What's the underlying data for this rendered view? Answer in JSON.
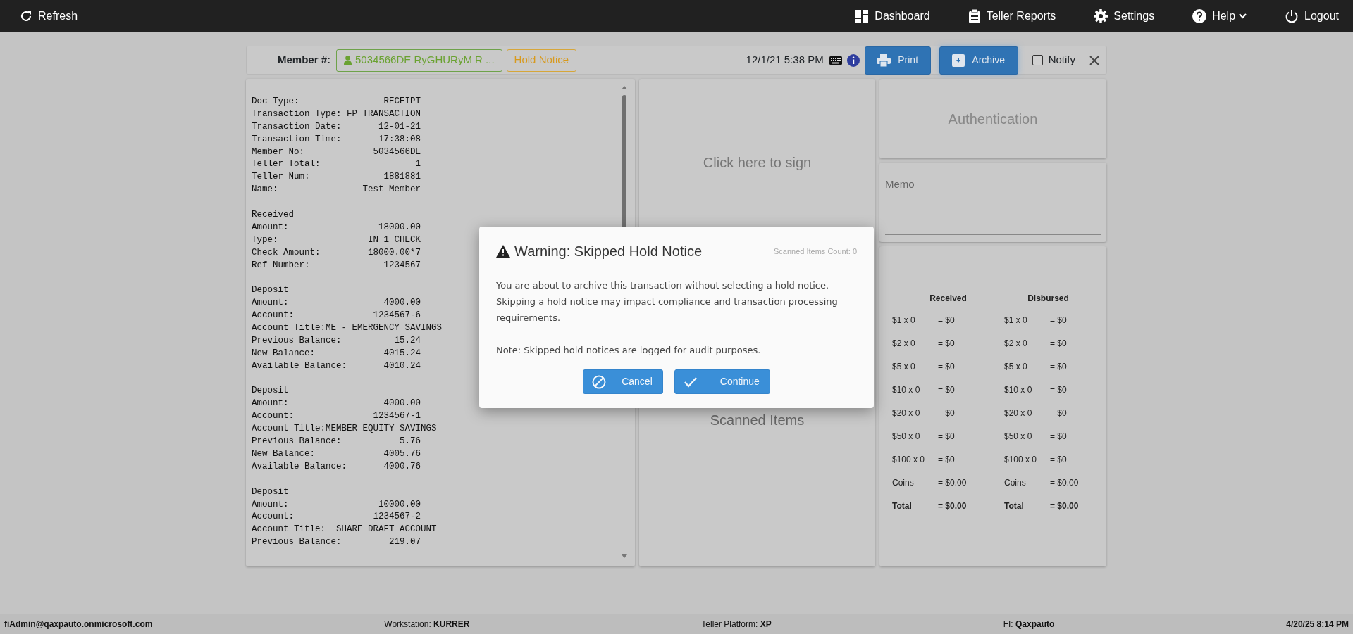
{
  "navbar": {
    "left": [
      {
        "label": "Refresh"
      }
    ],
    "right": [
      {
        "label": "Dashboard",
        "has_menu": false
      },
      {
        "label": "Teller Reports",
        "has_menu": false
      },
      {
        "label": "Settings",
        "has_menu": false
      },
      {
        "label": "Help",
        "has_menu": true
      },
      {
        "label": "Logout",
        "has_menu": false
      }
    ]
  },
  "member_bar": {
    "label": "Member #:",
    "member": "5034566DE RyGHURyM R ...",
    "hold_notice": "Hold Notice",
    "datetime": "12/1/21 5:38 PM",
    "buttons": [
      "Print",
      "Archive"
    ],
    "notify": {
      "label": "Notify",
      "checked": false
    }
  },
  "receipt": {
    "sections": [
      [
        {
          "kind": "pair",
          "label": "Doc Type:",
          "value": "RECEIPT"
        },
        {
          "kind": "pair",
          "label": "Transaction Type:",
          "value": "FP TRANSACTION"
        },
        {
          "kind": "pair",
          "label": "Transaction Date:",
          "value": "12-01-21"
        },
        {
          "kind": "pair",
          "label": "Transaction Time:",
          "value": "17:38:08"
        },
        {
          "kind": "pair",
          "label": "Member No:",
          "value": "5034566DE"
        },
        {
          "kind": "pair",
          "label": "Teller Total:",
          "value": "1"
        },
        {
          "kind": "pair",
          "label": "Teller Num:",
          "value": "1881881"
        },
        {
          "kind": "pair",
          "label": "Name:",
          "value": "Test Member"
        }
      ],
      [
        {
          "kind": "line",
          "text": "Received"
        },
        {
          "kind": "pair",
          "label": "Amount:",
          "value": "18000.00"
        },
        {
          "kind": "pair",
          "label": "Type:",
          "value": "IN 1 CHECK"
        },
        {
          "kind": "pair",
          "label": "Check Amount:",
          "value": "18000.00*7"
        },
        {
          "kind": "pair",
          "label": "Ref Number:",
          "value": "1234567"
        }
      ],
      [
        {
          "kind": "line",
          "text": "Deposit"
        },
        {
          "kind": "pair",
          "label": "Amount:",
          "value": "4000.00"
        },
        {
          "kind": "pair",
          "label": "Account:",
          "value": "1234567-6"
        },
        {
          "kind": "line",
          "text": "Account Title:ME - EMERGENCY SAVINGS"
        },
        {
          "kind": "pair",
          "label": "Previous Balance:",
          "value": "15.24"
        },
        {
          "kind": "pair",
          "label": "New Balance:",
          "value": "4015.24"
        },
        {
          "kind": "pair",
          "label": "Available Balance:",
          "value": "4010.24"
        }
      ],
      [
        {
          "kind": "line",
          "text": "Deposit"
        },
        {
          "kind": "pair",
          "label": "Amount:",
          "value": "4000.00"
        },
        {
          "kind": "pair",
          "label": "Account:",
          "value": "1234567-1"
        },
        {
          "kind": "line",
          "text": "Account Title:MEMBER EQUITY SAVINGS"
        },
        {
          "kind": "pair",
          "label": "Previous Balance:",
          "value": "5.76"
        },
        {
          "kind": "pair",
          "label": "New Balance:",
          "value": "4005.76"
        },
        {
          "kind": "pair",
          "label": "Available Balance:",
          "value": "4000.76"
        }
      ],
      [
        {
          "kind": "line",
          "text": "Deposit"
        },
        {
          "kind": "pair",
          "label": "Amount:",
          "value": "10000.00"
        },
        {
          "kind": "pair",
          "label": "Account:",
          "value": "1234567-2"
        },
        {
          "kind": "line",
          "text": "Account Title:  SHARE DRAFT ACCOUNT"
        },
        {
          "kind": "pair",
          "label": "Previous Balance:",
          "value": "219.07"
        }
      ]
    ]
  },
  "signature": {
    "prompt": "Click here to sign"
  },
  "scanned": {
    "title": "Scanned Items",
    "count": "Scanned Items Count: 0"
  },
  "authentication": {
    "title": "Authentication"
  },
  "memo": {
    "label": "Memo"
  },
  "cash": {
    "columns": [
      {
        "heading": "Received",
        "rows": [
          {
            "kind": "line",
            "label": "$1 x 0",
            "amount": "= $0"
          },
          {
            "kind": "line",
            "label": "$2 x 0",
            "amount": "= $0"
          },
          {
            "kind": "line",
            "label": "$5 x 0",
            "amount": "= $0"
          },
          {
            "kind": "line",
            "label": "$10 x 0",
            "amount": "= $0"
          },
          {
            "kind": "line",
            "label": "$20 x 0",
            "amount": "= $0"
          },
          {
            "kind": "line",
            "label": "$50 x 0",
            "amount": "= $0"
          },
          {
            "kind": "line",
            "label": "$100 x 0",
            "amount": "= $0"
          },
          {
            "kind": "line",
            "label": "Coins",
            "amount": "= $0.00"
          },
          {
            "kind": "total",
            "label": "Total",
            "amount": "= $0.00"
          }
        ]
      },
      {
        "heading": "Disbursed",
        "rows": [
          {
            "kind": "line",
            "label": "$1 x 0",
            "amount": "= $0"
          },
          {
            "kind": "line",
            "label": "$2 x 0",
            "amount": "= $0"
          },
          {
            "kind": "line",
            "label": "$5 x 0",
            "amount": "= $0"
          },
          {
            "kind": "line",
            "label": "$10 x 0",
            "amount": "= $0"
          },
          {
            "kind": "line",
            "label": "$20 x 0",
            "amount": "= $0"
          },
          {
            "kind": "line",
            "label": "$50 x 0",
            "amount": "= $0"
          },
          {
            "kind": "line",
            "label": "$100 x 0",
            "amount": "= $0"
          },
          {
            "kind": "line",
            "label": "Coins",
            "amount": "= $0.00"
          },
          {
            "kind": "total",
            "label": "Total",
            "amount": "= $0.00"
          }
        ]
      }
    ]
  },
  "modal": {
    "title": "Warning: Skipped Hold Notice",
    "paragraphs": [
      "You are about to archive this transaction without selecting a hold notice. Skipping a hold notice may impact compliance and transaction processing requirements.",
      "Note: Skipped hold notices are logged for audit purposes."
    ],
    "buttons": [
      {
        "kind": "cancel",
        "label": "Cancel"
      },
      {
        "kind": "confirm",
        "label": "Continue"
      }
    ]
  },
  "status_bar": {
    "user": "fiAdmin@qaxpauto.onmicrosoft.com",
    "items": [
      "Workstation: **KURRER**",
      "Teller Platform: **XP**",
      "FI: **Qaxpauto**"
    ],
    "time": "4/20/25 8:14 PM"
  }
}
